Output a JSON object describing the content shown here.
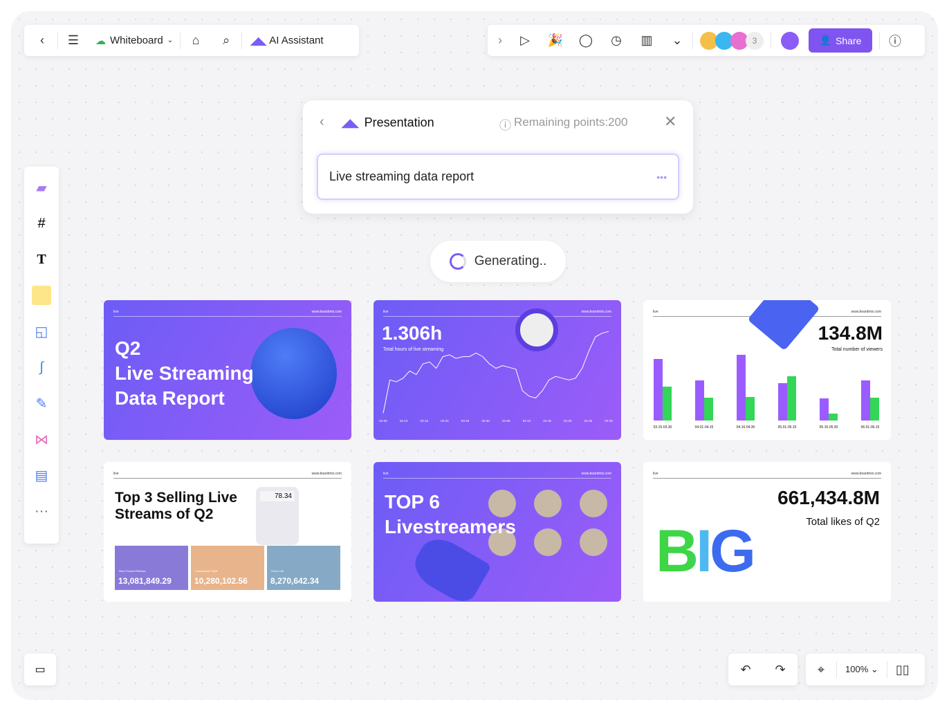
{
  "topbar": {
    "board_name": "Whiteboard",
    "ai_label": "AI Assistant",
    "extra_collaborators": "3",
    "share_label": "Share"
  },
  "panel": {
    "title": "Presentation",
    "points": "Remaining points:200",
    "input_value": "Live streaming data report"
  },
  "status": "Generating..",
  "zoom": "100%",
  "slides": [
    {
      "tag": "live",
      "site": "www.boardmix.com",
      "title_lines": [
        "Q2",
        "Live Streaming",
        "Data Report"
      ]
    },
    {
      "tag": "live",
      "site": "www.boardmix.com",
      "big": "1.306h",
      "sub": "Total hours of live streaming"
    },
    {
      "tag": "live",
      "site": "www.boardmix.com",
      "big": "134.8M",
      "sub": "Total number of viewers"
    },
    {
      "tag": "live",
      "site": "www.boardmix.com",
      "title_lines": [
        "Top 3 Selling Live",
        "Streams of Q2"
      ],
      "calc": "78.34",
      "cards": [
        {
          "label": "New Product Release",
          "value": "13,081,849.29",
          "color": "#8a7ad8"
        },
        {
          "label": "Fashionable Outfit",
          "value": "10,280,102.56",
          "color": "#e8b48c"
        },
        {
          "label": "Home Life",
          "value": "8,270,642.34",
          "color": "#86aac6"
        }
      ]
    },
    {
      "tag": "live",
      "site": "www.boardmix.com",
      "title_lines": [
        "TOP 6",
        "Livestreamers"
      ]
    },
    {
      "tag": "live",
      "site": "www.boardmix.com",
      "big": "661,434.8M",
      "sub": "Total likes of Q2",
      "art": "BIG"
    }
  ],
  "chart_data": [
    {
      "type": "line",
      "categories": [
        "03-05",
        "03-10",
        "03-15",
        "03-20",
        "03-25",
        "03-30",
        "04-05",
        "04-10",
        "04-15",
        "04-20",
        "04-25",
        "04-30"
      ],
      "values": [
        5,
        42,
        40,
        44,
        52,
        48,
        60,
        62,
        55,
        68,
        70,
        66,
        68,
        68,
        72,
        68,
        60,
        55,
        58,
        56,
        54,
        30,
        24,
        22,
        30,
        42,
        46,
        44,
        42,
        44,
        55,
        74,
        90,
        94,
        96
      ],
      "color": "#ffffff"
    },
    {
      "type": "bar",
      "categories": [
        "03.15-03.30",
        "04.01-04.15",
        "04.16-04.30",
        "05.01-05.15",
        "05.16-05.30",
        "06.01-06.15"
      ],
      "series": [
        {
          "values": [
            89,
            58,
            95,
            54,
            32,
            58
          ],
          "color": "#9b5cff"
        },
        {
          "values": [
            49,
            33,
            34,
            64,
            10,
            33
          ],
          "color": "#33d657"
        }
      ]
    }
  ],
  "colors": {
    "accent": "#7b5cf5",
    "share": "#8054f0"
  }
}
